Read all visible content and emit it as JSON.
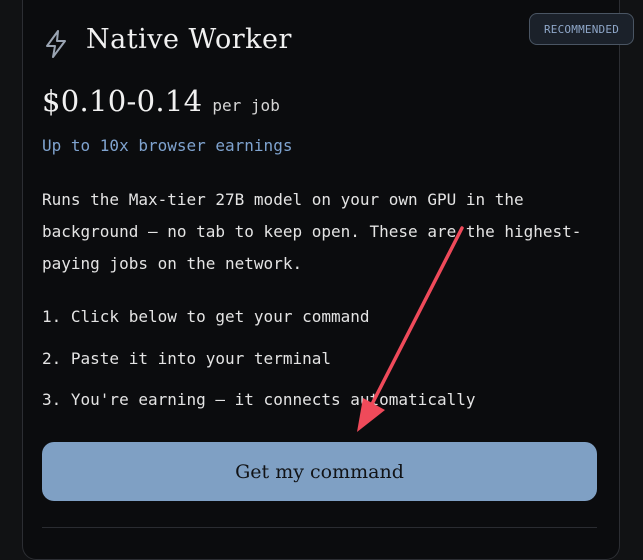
{
  "card": {
    "badge": "RECOMMENDED",
    "icon": "lightning-bolt-icon",
    "title": "Native Worker",
    "price": "$0.10-0.14",
    "price_unit": "per job",
    "earnings_note": "Up to 10x browser earnings",
    "description": "Runs the Max-tier 27B model on your own GPU in the background — no tab to keep open. These are the highest-paying jobs on the network.",
    "steps": [
      "1. Click below to get your command",
      "2. Paste it into your terminal",
      "3. You're earning — it connects automatically"
    ],
    "cta_label": "Get my command"
  },
  "colors": {
    "background": "#0b0c0e",
    "accent": "#7fa0c4",
    "accent_text": "#7fa3cf",
    "annotation_arrow": "#ef4a5a"
  }
}
